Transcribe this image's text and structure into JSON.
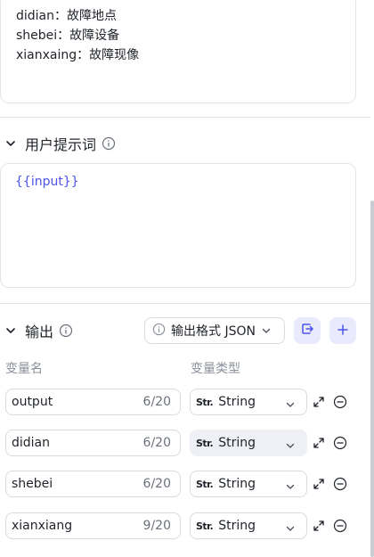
{
  "top_card": {
    "lines": [
      "didian：故障地点",
      "shebei：故障设备",
      "xianxaing：故障现像"
    ]
  },
  "user_prompt": {
    "title": "用户提示词",
    "content": "{{input}}"
  },
  "output": {
    "title": "输出",
    "format_button": "输出格式 JSON",
    "col_var_name": "变量名",
    "col_var_type": "变量类型",
    "rows": [
      {
        "name": "output",
        "count": "6/20",
        "type_abbr": "Str.",
        "type": "String"
      },
      {
        "name": "didian",
        "count": "6/20",
        "type_abbr": "Str.",
        "type": "String"
      },
      {
        "name": "shebei",
        "count": "6/20",
        "type_abbr": "Str.",
        "type": "String"
      },
      {
        "name": "xianxiang",
        "count": "9/20",
        "type_abbr": "Str.",
        "type": "String"
      }
    ]
  },
  "colors": {
    "accent": "#4d53e8",
    "border": "#e3e5ea",
    "accent_bg": "#e9eafc"
  }
}
